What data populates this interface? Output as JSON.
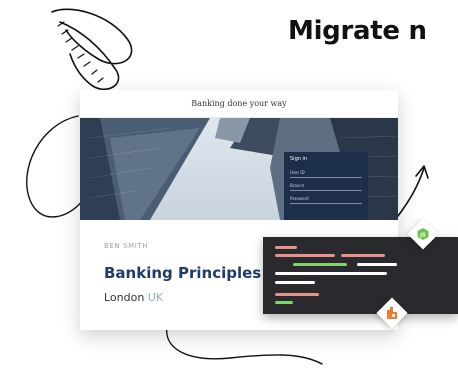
{
  "headline": "Migrate n",
  "card": {
    "header_text": "Banking done your way",
    "signin": {
      "title": "Sign in",
      "fields": [
        "User ID",
        "Branch",
        "Password"
      ]
    },
    "profile": {
      "name": "BEN SMITH",
      "title": "Banking Principles",
      "city": "London",
      "country": "UK"
    }
  },
  "code_lines": [
    {
      "color": "#e8908a"
    },
    {
      "color": "#e8908a"
    },
    {
      "color": "#e8908a"
    },
    {
      "color": "#7fd56b"
    },
    {
      "color": "#ffffff"
    },
    {
      "color": "#ffffff"
    },
    {
      "color": "#ffffff"
    },
    {
      "color": "#e8908a"
    },
    {
      "color": "#7fd56b"
    }
  ],
  "badges": {
    "nodejs_icon": "nodejs-icon",
    "bundle_icon": "bundle-icon",
    "nodejs_color": "#6cc24a",
    "bundle_color": "#f07b2e"
  }
}
